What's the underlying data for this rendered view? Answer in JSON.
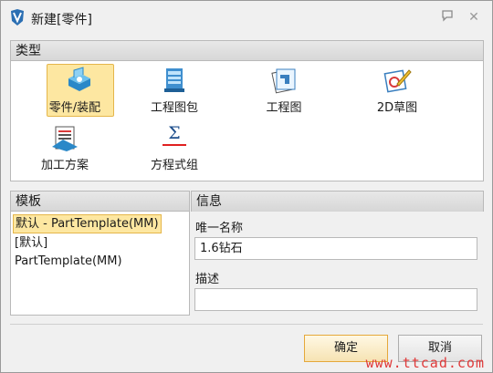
{
  "window": {
    "title": "新建[零件]",
    "help_glyph": "▭",
    "close_glyph": "✕"
  },
  "type_section": {
    "header": "类型",
    "items": [
      {
        "label": "零件/装配",
        "icon": "part-assembly-icon",
        "selected": true
      },
      {
        "label": "工程图包",
        "icon": "drawing-package-icon",
        "selected": false
      },
      {
        "label": "工程图",
        "icon": "drawing-icon",
        "selected": false
      },
      {
        "label": "2D草图",
        "icon": "sketch-2d-icon",
        "selected": false
      },
      {
        "label": "加工方案",
        "icon": "machining-plan-icon",
        "selected": false
      },
      {
        "label": "方程式组",
        "icon": "equation-set-icon",
        "selected": false
      }
    ],
    "equation_glyph": "Σ"
  },
  "template_section": {
    "header": "模板",
    "items": [
      {
        "label": "默认 - PartTemplate(MM)",
        "selected": true
      },
      {
        "label": "[默认]",
        "selected": false
      },
      {
        "label": "PartTemplate(MM)",
        "selected": false
      }
    ]
  },
  "info_section": {
    "header": "信息",
    "unique_name_label": "唯一名称",
    "unique_name_value": "1.6钻石",
    "description_label": "描述",
    "description_value": ""
  },
  "buttons": {
    "ok_label": "确定",
    "cancel_label": "取消"
  },
  "watermark": "www.ttcad.com",
  "colors": {
    "selection_fill": "#fde7a1",
    "selection_border": "#e5b64a",
    "header_bg": "#dcdcdc",
    "watermark": "#e03a3a"
  }
}
